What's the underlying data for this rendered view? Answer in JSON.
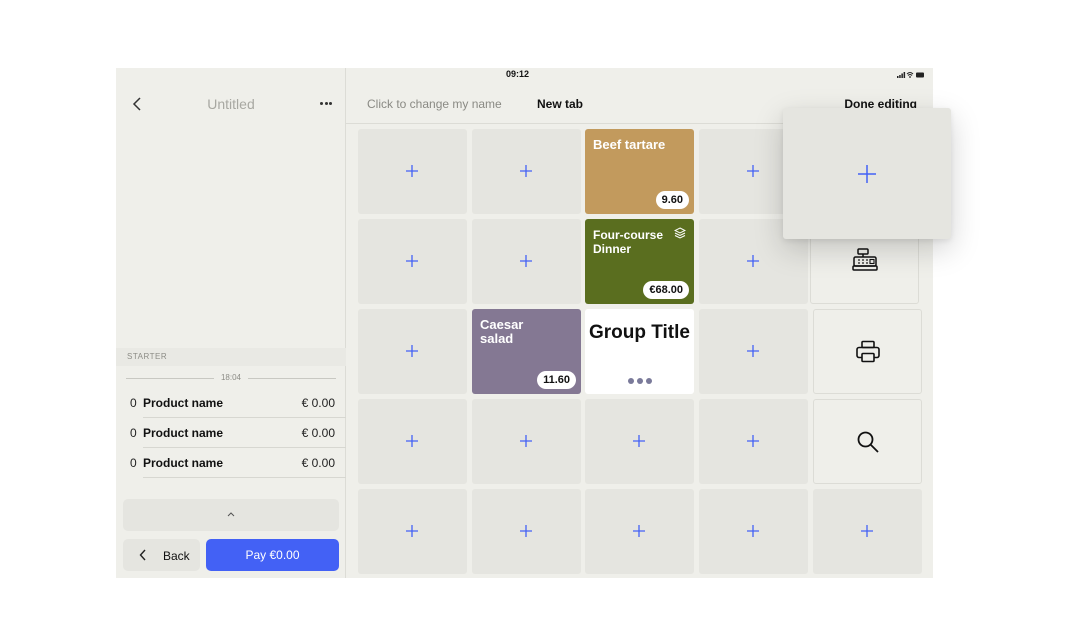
{
  "status_bar": {
    "time": "09:12"
  },
  "order_panel": {
    "title": "Untitled",
    "section_label": "STARTER",
    "time_separator": "18:04",
    "items": [
      {
        "qty": "0",
        "name": "Product name",
        "price": "€ 0.00"
      },
      {
        "qty": "0",
        "name": "Product name",
        "price": "€ 0.00"
      },
      {
        "qty": "0",
        "name": "Product name",
        "price": "€ 0.00"
      }
    ],
    "back_label": "Back",
    "pay_label": "Pay €0.00"
  },
  "top_bar": {
    "tabs": [
      {
        "label": "Click to change my name"
      },
      {
        "label": "New tab"
      }
    ],
    "done_label": "Done editing"
  },
  "grid": {
    "products": {
      "beef": {
        "name": "Beef tartare",
        "price": "9.60",
        "color": "#c29a5d"
      },
      "dinner": {
        "name": "Four-course Dinner",
        "price": "€68.00",
        "color": "#5a6e1f"
      },
      "caesar": {
        "name": "Caesar salad",
        "price": "11.60",
        "color": "#847893"
      }
    },
    "group": {
      "title": "Group Title"
    },
    "actions": [
      "cash-register-icon",
      "printer-icon",
      "search-icon"
    ]
  },
  "colors": {
    "accent": "#4361f5",
    "plus": "#4361f5"
  }
}
